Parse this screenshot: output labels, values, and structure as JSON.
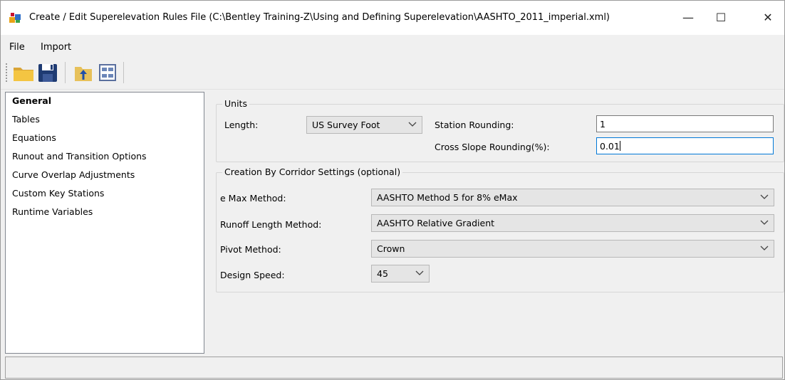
{
  "window": {
    "title": "Create / Edit Superelevation Rules File (C:\\Bentley Training-Z\\Using and Defining Superelevation\\AASHTO_2011_imperial.xml)",
    "minimize_glyph": "—",
    "maximize_glyph": "☐",
    "close_glyph": "✕"
  },
  "menu": {
    "file": "File",
    "import": "Import"
  },
  "toolbar": {
    "icons": [
      "open-folder-icon",
      "save-icon",
      "import-file-icon",
      "table-icon"
    ]
  },
  "nav": {
    "items": [
      {
        "label": "General",
        "selected": true
      },
      {
        "label": "Tables"
      },
      {
        "label": "Equations"
      },
      {
        "label": "Runout and Transition Options"
      },
      {
        "label": "Curve Overlap Adjustments"
      },
      {
        "label": "Custom Key Stations"
      },
      {
        "label": "Runtime Variables"
      }
    ]
  },
  "units": {
    "title": "Units",
    "length_label": "Length:",
    "length_value": "US Survey Foot",
    "station_rounding_label": "Station Rounding:",
    "station_rounding_value": "1",
    "cross_slope_label": "Cross Slope Rounding(%):",
    "cross_slope_value": "0.01"
  },
  "corridor": {
    "title": "Creation By Corridor Settings (optional)",
    "emax_label": "e Max Method:",
    "emax_value": "AASHTO Method 5 for 8% eMax",
    "runoff_label": "Runoff Length Method:",
    "runoff_value": "AASHTO Relative Gradient",
    "pivot_label": "Pivot Method:",
    "pivot_value": "Crown",
    "speed_label": "Design Speed:",
    "speed_value": "45"
  },
  "colors": {
    "accent": "#0078d7",
    "window_bg": "#f0f0f0",
    "combo_bg": "#e5e5e5"
  }
}
